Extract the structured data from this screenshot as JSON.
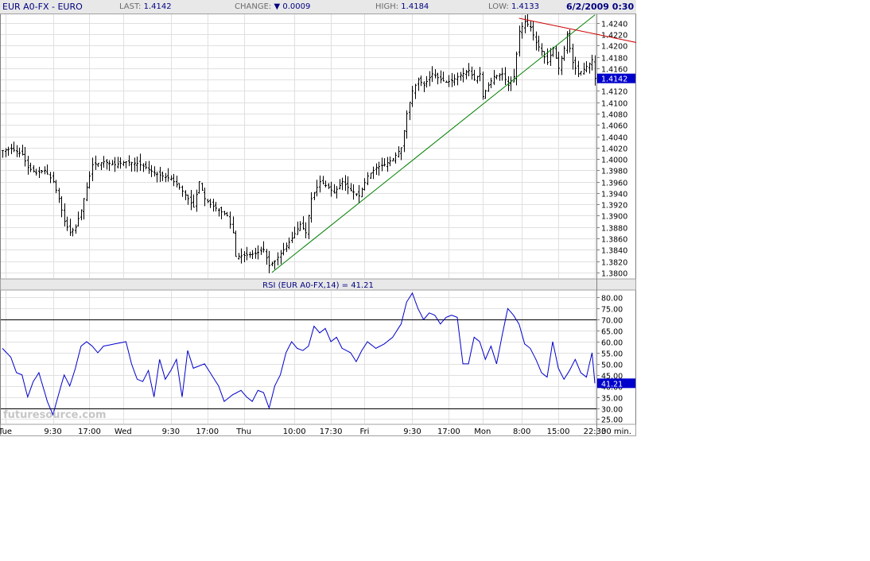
{
  "header": {
    "title": "EUR A0-FX - EURO",
    "last_label": "LAST:",
    "last_value": "1.4142",
    "change_label": "CHANGE:",
    "change_arrow": "▼",
    "change_value": "0.0009",
    "high_label": "HIGH:",
    "high_value": "1.4184",
    "low_label": "LOW:",
    "low_value": "1.4133",
    "datetime": "6/2/2009 0:30"
  },
  "colors": {
    "candles": "#000000",
    "rsi_line": "#0000cc",
    "trend_up": "#008000",
    "trend_down": "#cc0000",
    "grid": "#e0e0e0",
    "current_badge": "#0000cc",
    "watermark": "#b8b8b8"
  },
  "watermark": "futuresource.com",
  "chart_data": [
    {
      "type": "candlestick",
      "title": "EUR A0-FX - EURO",
      "interval": "30 min.",
      "ylim": [
        1.379,
        1.4255
      ],
      "y_ticks": [
        "1.4240",
        "1.4220",
        "1.4200",
        "1.4180",
        "1.4160",
        "1.4140",
        "1.4120",
        "1.4100",
        "1.4080",
        "1.4060",
        "1.4040",
        "1.4020",
        "1.4000",
        "1.3980",
        "1.3960",
        "1.3940",
        "1.3920",
        "1.3900",
        "1.3880",
        "1.3860",
        "1.3840",
        "1.3820",
        "1.3800"
      ],
      "grid": true,
      "last_price_label": "1.4142",
      "x_tick_labels": [
        "Tue",
        "9:30",
        "17:00",
        "Wed",
        "9:30",
        "17:00",
        "Thu",
        "10:00",
        "17:30",
        "Fri",
        "9:30",
        "17:00",
        "Mon",
        "8:00",
        "15:00",
        "22:30"
      ],
      "x_tick_index": [
        1,
        18,
        31,
        43,
        60,
        73,
        86,
        104,
        117,
        129,
        146,
        159,
        171,
        185,
        198,
        211
      ],
      "x_count": 212,
      "close_anchors": [
        [
          0,
          1.4015
        ],
        [
          3,
          1.4018
        ],
        [
          7,
          1.4008
        ],
        [
          9,
          1.3985
        ],
        [
          12,
          1.3975
        ],
        [
          15,
          1.398
        ],
        [
          18,
          1.396
        ],
        [
          20,
          1.393
        ],
        [
          22,
          1.389
        ],
        [
          24,
          1.387
        ],
        [
          26,
          1.388
        ],
        [
          28,
          1.391
        ],
        [
          30,
          1.395
        ],
        [
          32,
          1.399
        ],
        [
          36,
          1.3995
        ],
        [
          40,
          1.399
        ],
        [
          44,
          1.3995
        ],
        [
          48,
          1.3992
        ],
        [
          51,
          1.3985
        ],
        [
          54,
          1.3975
        ],
        [
          57,
          1.397
        ],
        [
          60,
          1.3965
        ],
        [
          63,
          1.395
        ],
        [
          66,
          1.393
        ],
        [
          68,
          1.3915
        ],
        [
          70,
          1.396
        ],
        [
          72,
          1.393
        ],
        [
          74,
          1.392
        ],
        [
          77,
          1.391
        ],
        [
          80,
          1.39
        ],
        [
          82,
          1.387
        ],
        [
          83,
          1.3828
        ],
        [
          86,
          1.383
        ],
        [
          90,
          1.3833
        ],
        [
          93,
          1.384
        ],
        [
          95,
          1.3812
        ],
        [
          97,
          1.382
        ],
        [
          100,
          1.384
        ],
        [
          103,
          1.386
        ],
        [
          106,
          1.3885
        ],
        [
          108,
          1.387
        ],
        [
          110,
          1.393
        ],
        [
          113,
          1.396
        ],
        [
          116,
          1.395
        ],
        [
          118,
          1.394
        ],
        [
          121,
          1.396
        ],
        [
          124,
          1.3945
        ],
        [
          127,
          1.3935
        ],
        [
          130,
          1.397
        ],
        [
          133,
          1.3985
        ],
        [
          136,
          1.399
        ],
        [
          139,
          1.4
        ],
        [
          142,
          1.402
        ],
        [
          144,
          1.408
        ],
        [
          146,
          1.412
        ],
        [
          148,
          1.414
        ],
        [
          150,
          1.413
        ],
        [
          153,
          1.415
        ],
        [
          156,
          1.414
        ],
        [
          158,
          1.4135
        ],
        [
          160,
          1.4138
        ],
        [
          163,
          1.4148
        ],
        [
          166,
          1.4156
        ],
        [
          168,
          1.414
        ],
        [
          170,
          1.415
        ],
        [
          171,
          1.411
        ],
        [
          173,
          1.413
        ],
        [
          175,
          1.4145
        ],
        [
          178,
          1.415
        ],
        [
          180,
          1.413
        ],
        [
          182,
          1.4145
        ],
        [
          184,
          1.4225
        ],
        [
          186,
          1.4242
        ],
        [
          188,
          1.4232
        ],
        [
          190,
          1.4205
        ],
        [
          192,
          1.419
        ],
        [
          194,
          1.417
        ],
        [
          196,
          1.4195
        ],
        [
          198,
          1.416
        ],
        [
          200,
          1.4195
        ],
        [
          201,
          1.422
        ],
        [
          203,
          1.417
        ],
        [
          205,
          1.415
        ],
        [
          207,
          1.4158
        ],
        [
          209,
          1.4168
        ],
        [
          210,
          1.4175
        ],
        [
          211,
          1.4142
        ]
      ]
    },
    {
      "type": "line",
      "title": "RSI (EUR A0-FX,14) = 41.21",
      "series": [
        {
          "name": "RSI (EUR A0-FX,14)",
          "last": "41.21"
        }
      ],
      "ylim": [
        23,
        83
      ],
      "y_ticks": [
        "80.00",
        "75.00",
        "70.00",
        "65.00",
        "60.00",
        "55.00",
        "50.00",
        "45.00",
        "40.00",
        "35.00",
        "30.00",
        "25.00"
      ],
      "reference_lines": [
        70,
        30
      ],
      "values_anchor": [
        [
          0,
          57
        ],
        [
          3,
          53
        ],
        [
          5,
          46
        ],
        [
          7,
          45
        ],
        [
          9,
          35
        ],
        [
          11,
          42
        ],
        [
          13,
          46
        ],
        [
          16,
          33
        ],
        [
          18,
          27
        ],
        [
          20,
          36
        ],
        [
          22,
          45
        ],
        [
          24,
          40
        ],
        [
          26,
          48
        ],
        [
          28,
          58
        ],
        [
          30,
          60
        ],
        [
          32,
          58
        ],
        [
          34,
          55
        ],
        [
          36,
          58
        ],
        [
          40,
          59
        ],
        [
          44,
          60
        ],
        [
          46,
          50
        ],
        [
          48,
          43
        ],
        [
          50,
          42
        ],
        [
          52,
          47
        ],
        [
          54,
          35
        ],
        [
          56,
          52
        ],
        [
          58,
          43
        ],
        [
          60,
          47
        ],
        [
          62,
          52
        ],
        [
          64,
          35
        ],
        [
          66,
          56
        ],
        [
          68,
          48
        ],
        [
          70,
          49
        ],
        [
          72,
          50
        ],
        [
          74,
          46
        ],
        [
          77,
          40
        ],
        [
          79,
          33
        ],
        [
          82,
          36
        ],
        [
          85,
          38
        ],
        [
          87,
          35
        ],
        [
          89,
          33
        ],
        [
          91,
          38
        ],
        [
          93,
          37
        ],
        [
          95,
          30
        ],
        [
          97,
          40
        ],
        [
          99,
          45
        ],
        [
          101,
          55
        ],
        [
          103,
          60
        ],
        [
          105,
          57
        ],
        [
          107,
          56
        ],
        [
          109,
          58
        ],
        [
          111,
          67
        ],
        [
          113,
          64
        ],
        [
          115,
          66
        ],
        [
          117,
          60
        ],
        [
          119,
          62
        ],
        [
          121,
          57
        ],
        [
          124,
          55
        ],
        [
          126,
          51
        ],
        [
          128,
          56
        ],
        [
          130,
          60
        ],
        [
          133,
          57
        ],
        [
          136,
          59
        ],
        [
          139,
          62
        ],
        [
          142,
          68
        ],
        [
          144,
          78
        ],
        [
          146,
          82
        ],
        [
          148,
          75
        ],
        [
          150,
          70
        ],
        [
          152,
          73
        ],
        [
          154,
          72
        ],
        [
          156,
          68
        ],
        [
          158,
          71
        ],
        [
          160,
          72
        ],
        [
          162,
          71
        ],
        [
          164,
          50
        ],
        [
          166,
          50
        ],
        [
          168,
          62
        ],
        [
          170,
          60
        ],
        [
          172,
          52
        ],
        [
          174,
          58
        ],
        [
          176,
          50
        ],
        [
          178,
          63
        ],
        [
          180,
          75
        ],
        [
          182,
          72
        ],
        [
          184,
          68
        ],
        [
          186,
          59
        ],
        [
          188,
          57
        ],
        [
          190,
          52
        ],
        [
          192,
          46
        ],
        [
          194,
          44
        ],
        [
          196,
          60
        ],
        [
          198,
          48
        ],
        [
          200,
          43
        ],
        [
          202,
          47
        ],
        [
          204,
          52
        ],
        [
          206,
          46
        ],
        [
          208,
          44
        ],
        [
          210,
          55
        ],
        [
          211,
          41.21
        ]
      ]
    }
  ]
}
